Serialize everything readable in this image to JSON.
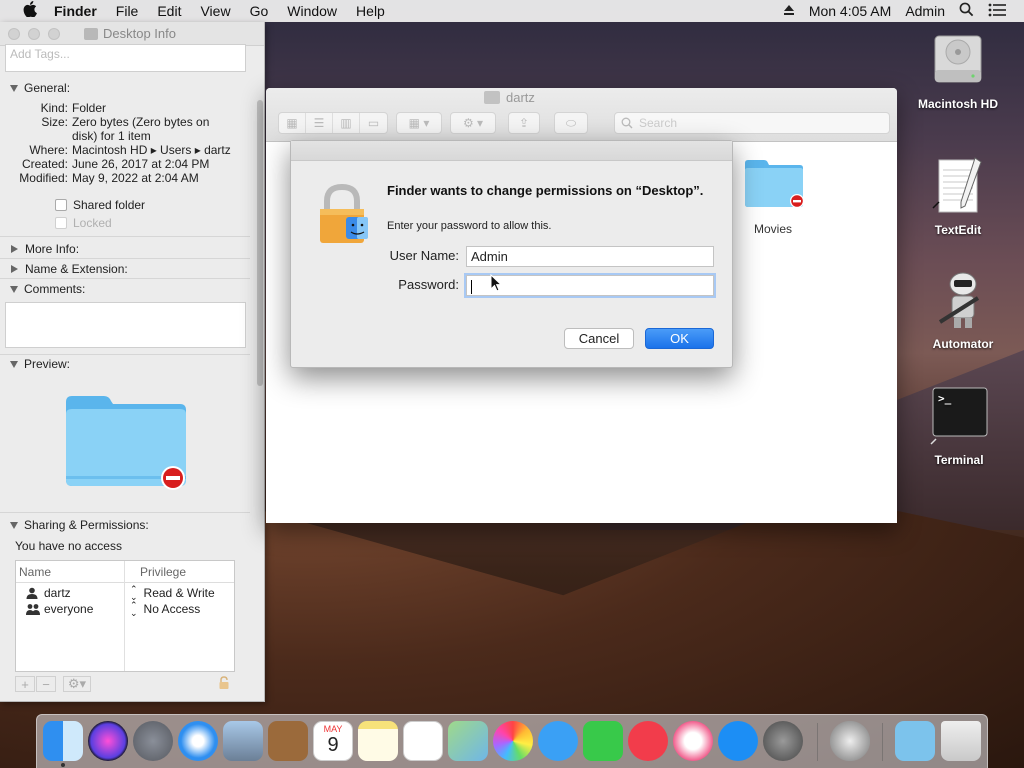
{
  "menubar": {
    "app_name": "Finder",
    "menus": [
      "File",
      "Edit",
      "View",
      "Go",
      "Window",
      "Help"
    ],
    "clock": "Mon 4:05 AM",
    "user": "Admin"
  },
  "info_panel": {
    "title": "Desktop Info",
    "tags_placeholder": "Add Tags...",
    "general_label": "General:",
    "kind_key": "Kind:",
    "kind_val": "Folder",
    "size_key": "Size:",
    "size_val_1": "Zero bytes (Zero bytes on",
    "size_val_2": "disk) for 1 item",
    "where_key": "Where:",
    "where_val": "Macintosh HD ▸ Users ▸ dartz",
    "created_key": "Created:",
    "created_val": "June 26, 2017 at 2:04 PM",
    "modified_key": "Modified:",
    "modified_val": "May 9, 2022 at 2:04 AM",
    "shared_folder": "Shared folder",
    "locked": "Locked",
    "more_info": "More Info:",
    "name_ext": "Name & Extension:",
    "comments": "Comments:",
    "preview": "Preview:",
    "sharing": "Sharing & Permissions:",
    "access_msg": "You have no access",
    "perm_headers": {
      "name": "Name",
      "privilege": "Privilege"
    },
    "perm_rows": [
      {
        "name": "dartz",
        "privilege": "Read & Write"
      },
      {
        "name": "everyone",
        "privilege": "No Access"
      }
    ]
  },
  "finder": {
    "title": "dartz",
    "search_placeholder": "Search",
    "item_label": "Movies"
  },
  "dialog": {
    "headline": "Finder wants to change permissions on “Desktop”.",
    "sub": "Enter your password to allow this.",
    "username_label": "User Name:",
    "username_value": "Admin",
    "password_label": "Password:",
    "cancel_label": "Cancel",
    "ok_label": "OK"
  },
  "desktop_icons": {
    "hd": "Macintosh HD",
    "textedit": "TextEdit",
    "automator": "Automator",
    "terminal": "Terminal"
  },
  "dock_calendar": {
    "month": "MAY",
    "day": "9"
  },
  "colors": {
    "accent": "#1b72ea",
    "folder": "#6cc3f3",
    "danger": "#d81e1e"
  }
}
